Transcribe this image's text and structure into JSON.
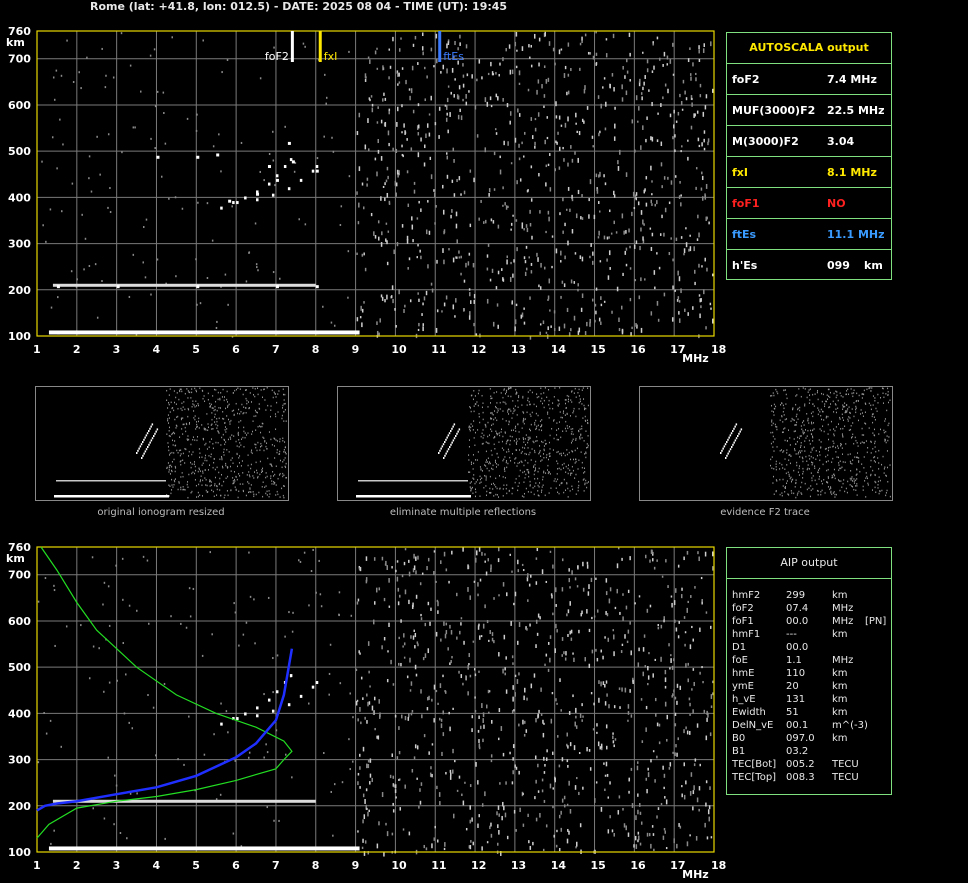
{
  "header": "Rome (lat: +41.8, lon: 012.5) - DATE: 2025 08 04 - TIME (UT): 19:45",
  "axis": {
    "km_label": "km",
    "mhz_label": "MHz",
    "y_ticks": [
      "760",
      "700",
      "600",
      "500",
      "400",
      "300",
      "200",
      "100"
    ],
    "x_ticks": [
      "1",
      "2",
      "3",
      "4",
      "5",
      "6",
      "7",
      "8",
      "9",
      "10",
      "11",
      "12",
      "13",
      "14",
      "15",
      "16",
      "17",
      "18"
    ]
  },
  "markers": [
    {
      "label": "foF2",
      "freq": 7.4,
      "color": "#ffffff"
    },
    {
      "label": "fxI",
      "freq": 8.1,
      "color": "#ffe800"
    },
    {
      "label": "ftEs",
      "freq": 11.1,
      "color": "#3a7bff"
    }
  ],
  "autoscala": {
    "title": "AUTOSCALA output",
    "rows": [
      {
        "label": "foF2",
        "value": "7.4 MHz",
        "unit": "",
        "color": "#ffffff"
      },
      {
        "label": "MUF(3000)F2",
        "value": "22.5 MHz",
        "unit": "",
        "color": "#ffffff"
      },
      {
        "label": "M(3000)F2",
        "value": "3.04",
        "unit": "",
        "color": "#ffffff"
      },
      {
        "label": "fxI",
        "value": "8.1 MHz",
        "unit": "",
        "color": "#ffe800"
      },
      {
        "label": "foF1",
        "value": "NO",
        "unit": "",
        "color": "#ff2020"
      },
      {
        "label": "ftEs",
        "value": "11.1 MHz",
        "unit": "",
        "color": "#3a9bff"
      },
      {
        "label": "h'Es",
        "value": "099",
        "unit": "km",
        "color": "#ffffff"
      }
    ]
  },
  "aip": {
    "title": "AIP output",
    "rows": [
      {
        "k": "hmF2",
        "v": "299",
        "u": "km",
        "x": ""
      },
      {
        "k": "foF2",
        "v": "07.4",
        "u": "MHz",
        "x": ""
      },
      {
        "k": "foF1",
        "v": "00.0",
        "u": "MHz",
        "x": "[PN]"
      },
      {
        "k": "hmF1",
        "v": "---",
        "u": "km",
        "x": ""
      },
      {
        "k": "D1",
        "v": "00.0",
        "u": "",
        "x": ""
      },
      {
        "k": "foE",
        "v": "1.1",
        "u": "MHz",
        "x": ""
      },
      {
        "k": "hmE",
        "v": "110",
        "u": "km",
        "x": ""
      },
      {
        "k": "ymE",
        "v": "20",
        "u": "km",
        "x": ""
      },
      {
        "k": "h_vE",
        "v": "131",
        "u": "km",
        "x": ""
      },
      {
        "k": "Ewidth",
        "v": "51",
        "u": "km",
        "x": ""
      },
      {
        "k": "DelN_vE",
        "v": "00.1",
        "u": "m^(-3)",
        "x": ""
      },
      {
        "k": "B0",
        "v": "097.0",
        "u": "km",
        "x": ""
      },
      {
        "k": "B1",
        "v": "03.2",
        "u": "",
        "x": ""
      },
      {
        "k": "TEC[Bot]",
        "v": "005.2",
        "u": "TECU",
        "x": ""
      },
      {
        "k": "TEC[Top]",
        "v": "008.3",
        "u": "TECU",
        "x": ""
      }
    ]
  },
  "thumbnails": [
    {
      "caption": "original ionogram resized"
    },
    {
      "caption": "eliminate multiple reflections"
    },
    {
      "caption": "evidence F2 trace"
    }
  ],
  "colors": {
    "frame": "#e8d800",
    "grid": "#7a7a7a",
    "panel_border": "#7fe07f",
    "trace": "#ffffff",
    "profile": "#1f2fff",
    "model": "#22dd22"
  },
  "chart_data": [
    {
      "type": "scatter",
      "title": "",
      "xlabel": "MHz",
      "ylabel": "km",
      "xlim": [
        1,
        18
      ],
      "ylim": [
        100,
        760
      ],
      "grid": true,
      "series": [
        {
          "name": "",
          "points": [
            [
              1.5,
              110
            ],
            [
              2,
              110
            ],
            [
              3,
              110
            ],
            [
              4,
              110
            ],
            [
              5,
              110
            ],
            [
              6,
              110
            ],
            [
              7,
              110
            ],
            [
              8,
              110
            ],
            [
              9,
              110
            ],
            [
              1.5,
              210
            ],
            [
              3,
              210
            ],
            [
              5,
              210
            ],
            [
              7,
              210
            ],
            [
              8,
              210
            ],
            [
              5.8,
              395
            ],
            [
              6.5,
              410
            ],
            [
              7,
              440
            ],
            [
              7.4,
              480
            ],
            [
              6.8,
              470
            ],
            [
              7.3,
              520
            ],
            [
              8,
              460
            ],
            [
              4,
              490
            ],
            [
              5,
              490
            ],
            [
              5.5,
              495
            ]
          ]
        }
      ]
    },
    {
      "type": "line",
      "title": "",
      "xlabel": "MHz",
      "ylabel": "km",
      "xlim": [
        1,
        18
      ],
      "ylim": [
        100,
        760
      ],
      "grid": true,
      "series": [
        {
          "name": "",
          "x": [
            1.0,
            1.2,
            1.5,
            2,
            3,
            4,
            5,
            6,
            6.5,
            7,
            7.2,
            7.4
          ],
          "y": [
            190,
            200,
            205,
            210,
            225,
            240,
            265,
            305,
            335,
            385,
            440,
            540
          ]
        },
        {
          "name": "",
          "x": [
            1.0,
            1.3,
            2,
            3,
            4,
            5,
            6,
            7,
            7.2,
            7.4,
            7.2,
            6.5,
            5.5,
            4.5,
            3.5,
            2.5,
            2,
            1.5,
            1.1
          ],
          "y": [
            130,
            160,
            195,
            210,
            220,
            235,
            255,
            280,
            300,
            318,
            340,
            370,
            400,
            440,
            500,
            580,
            640,
            710,
            760
          ]
        }
      ]
    }
  ]
}
